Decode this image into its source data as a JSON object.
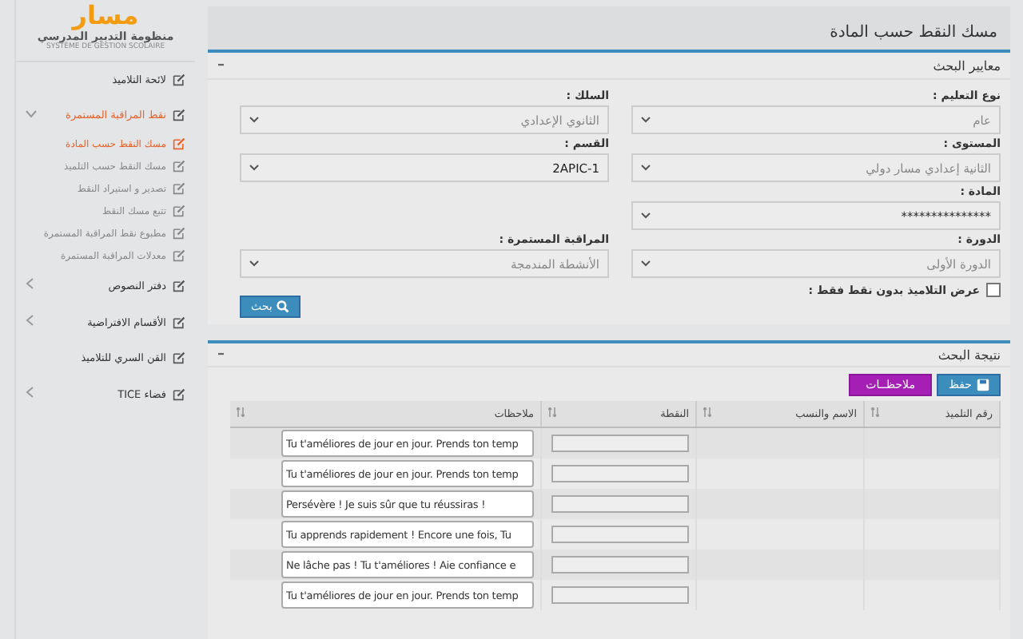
{
  "page_title": "مسك النقط حسب المادة",
  "criteria": {
    "title": "معايير البحث",
    "collapse": "–",
    "rows": [
      {
        "cells": [
          {
            "label": "نوع التعليم :",
            "value": "عام",
            "disabled": true
          },
          {
            "label": "السلك :",
            "value": "الثانوي الإعدادي",
            "disabled": true
          }
        ]
      },
      {
        "cells": [
          {
            "label": "المستوى :",
            "value": "الثانية إعدادي مسار دولي",
            "disabled": true
          },
          {
            "label": "القسم :",
            "value": "2APIC-1",
            "disabled": false
          }
        ]
      },
      {
        "cells": [
          {
            "label": "المادة :",
            "value": "***************",
            "disabled": false
          }
        ]
      },
      {
        "cells": [
          {
            "label": "الدورة :",
            "value": "الدورة الأولى",
            "disabled": true
          },
          {
            "label": "المراقبة المستمرة :",
            "value": "الأنشطة المندمجة",
            "disabled": true
          }
        ]
      }
    ],
    "checkbox": {
      "label": "عرض التلاميذ بدون نقط فقط :",
      "checked": false
    },
    "search_button": "بحث"
  },
  "results": {
    "title": "نتيجة البحث",
    "collapse": "–",
    "save_button": "حفظ",
    "notes_button": "ملاحظــات",
    "columns": [
      "رقم التلميذ",
      "الاسم والنسب",
      "النقطة",
      "ملاحظات"
    ],
    "rows": [
      {
        "remark": "Tu t'améliores de jour en jour. Prends ton temp"
      },
      {
        "remark": "Tu t'améliores de jour en jour. Prends ton temp"
      },
      {
        "remark": "Persévère ! Je suis sûr que tu réussiras !"
      },
      {
        "remark": "Tu apprends rapidement ! Encore une fois, Tu"
      },
      {
        "remark": "Ne lâche pas ! Tu t'améliores ! Aie confiance e"
      },
      {
        "remark": "Tu t'améliores de jour en jour. Prends ton temp"
      }
    ]
  },
  "sidebar": {
    "logo": "مسار",
    "subtitle": "منظومة التدبير المدرسي",
    "subtitle_fr": "SYSTÈME DE GESTION SCOLAIRE",
    "items": [
      {
        "label": "لائحة التلاميذ",
        "kind": "link"
      },
      {
        "label": "نقط المراقبة المستمرة",
        "kind": "group",
        "expanded": true,
        "children": [
          {
            "label": "مسك النقط حسب المادة",
            "selected": true
          },
          {
            "label": "مسك النقط حسب التلميذ",
            "selected": false
          },
          {
            "label": "تصدير و استيراد النقط",
            "selected": false
          },
          {
            "label": "تتبع مسك النقط",
            "selected": false
          },
          {
            "label": "مطبوع نقط المراقبة المستمرة",
            "selected": false
          },
          {
            "label": "معدلات المراقبة المستمرة",
            "selected": false
          }
        ]
      },
      {
        "label": "دفتر النصوص",
        "kind": "group",
        "expanded": false
      },
      {
        "label": "الأقسام الافتراضية",
        "kind": "group",
        "expanded": false
      },
      {
        "label": "القن السري للتلاميذ",
        "kind": "link"
      },
      {
        "label": "فضاء TICE",
        "kind": "group",
        "expanded": false
      }
    ]
  }
}
